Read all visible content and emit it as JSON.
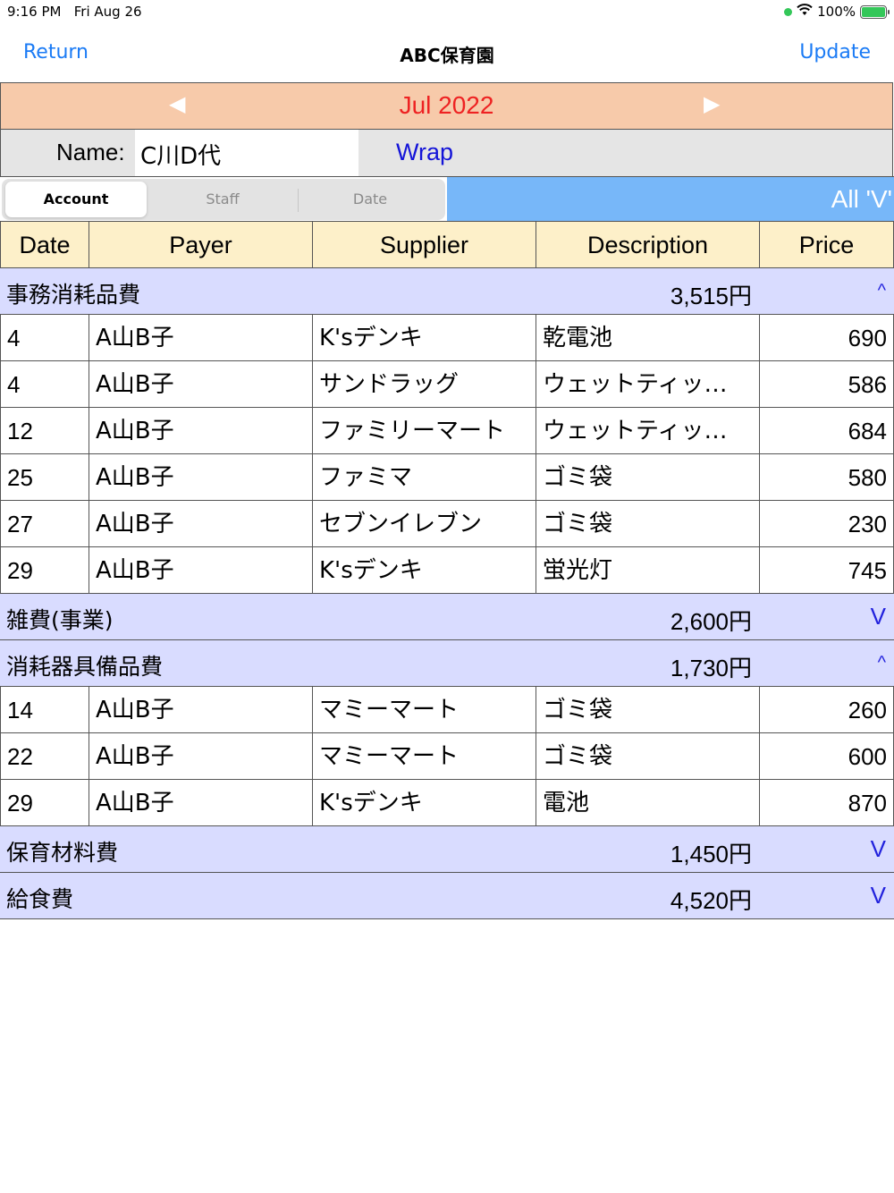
{
  "status": {
    "time": "9:16 PM",
    "date": "Fri Aug 26",
    "battery": "100%"
  },
  "nav": {
    "back_label": "Return",
    "title": "ABC保育園",
    "update_label": "Update"
  },
  "month": {
    "prev": "◀",
    "label": "Jul 2022",
    "next": "▶"
  },
  "name_row": {
    "label": "Name:",
    "value": "C川D代",
    "wrap_label": "Wrap"
  },
  "segments": {
    "account": "Account",
    "staff": "Staff",
    "date": "Date"
  },
  "filter_text": "All 'V'",
  "table": {
    "headers": [
      "Date",
      "Payer",
      "Supplier",
      "Description",
      "Price"
    ],
    "groups": [
      {
        "name": "事務消耗品費",
        "amount": "3,515円",
        "toggle": "^",
        "rows": [
          [
            "4",
            "A山B子",
            "K'sデンキ",
            "乾電池",
            "690"
          ],
          [
            "4",
            "A山B子",
            "サンドラッグ",
            "ウェットティッ…",
            "586"
          ],
          [
            "12",
            "A山B子",
            "ファミリーマート",
            "ウェットティッ…",
            "684"
          ],
          [
            "25",
            "A山B子",
            "ファミマ",
            "ゴミ袋",
            "580"
          ],
          [
            "27",
            "A山B子",
            "セブンイレブン",
            "ゴミ袋",
            "230"
          ],
          [
            "29",
            "A山B子",
            "K'sデンキ",
            "蛍光灯",
            "745"
          ]
        ]
      },
      {
        "name": "雑費(事業)",
        "amount": "2,600円",
        "toggle": "V",
        "rows": []
      },
      {
        "name": "消耗器具備品費",
        "amount": "1,730円",
        "toggle": "^",
        "rows": [
          [
            "14",
            "A山B子",
            "マミーマート",
            "ゴミ袋",
            "260"
          ],
          [
            "22",
            "A山B子",
            "マミーマート",
            "ゴミ袋",
            "600"
          ],
          [
            "29",
            "A山B子",
            "K'sデンキ",
            "電池",
            "870"
          ]
        ]
      },
      {
        "name": "保育材料費",
        "amount": "1,450円",
        "toggle": "V",
        "rows": []
      },
      {
        "name": "給食費",
        "amount": "4,520円",
        "toggle": "V",
        "rows": []
      }
    ]
  },
  "colors": {
    "accent": "#1b7bf5",
    "month_bg": "#f7caaa",
    "month_text": "#ee2222",
    "group_bg": "#d9dcff",
    "header_bg": "#fdf0c9",
    "filter_bg": "#77b7f9"
  }
}
